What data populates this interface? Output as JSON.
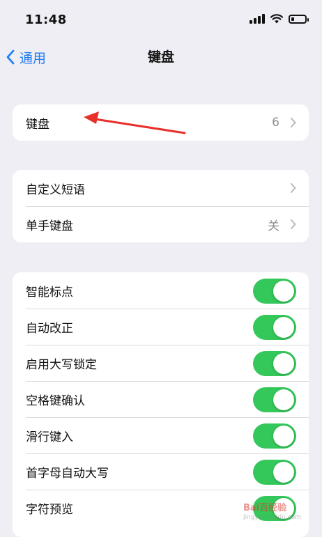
{
  "status": {
    "time": "11:48"
  },
  "nav": {
    "back_label": "通用",
    "title": "键盘"
  },
  "group1": [
    {
      "label": "键盘",
      "value": "6"
    }
  ],
  "group2": [
    {
      "label": "自定义短语",
      "value": ""
    },
    {
      "label": "单手键盘",
      "value": "关"
    }
  ],
  "group3": [
    {
      "label": "智能标点",
      "on": true
    },
    {
      "label": "自动改正",
      "on": true
    },
    {
      "label": "启用大写锁定",
      "on": true
    },
    {
      "label": "空格键确认",
      "on": true
    },
    {
      "label": "滑行键入",
      "on": true
    },
    {
      "label": "首字母自动大写",
      "on": true
    },
    {
      "label": "字符预览",
      "on": true
    }
  ],
  "watermark": {
    "text": "Bai百经验",
    "url": "jingyan.baidu.com"
  },
  "colors": {
    "accent": "#1f7ef2",
    "toggle_on": "#34c759",
    "annotation_arrow": "#e8302a"
  }
}
